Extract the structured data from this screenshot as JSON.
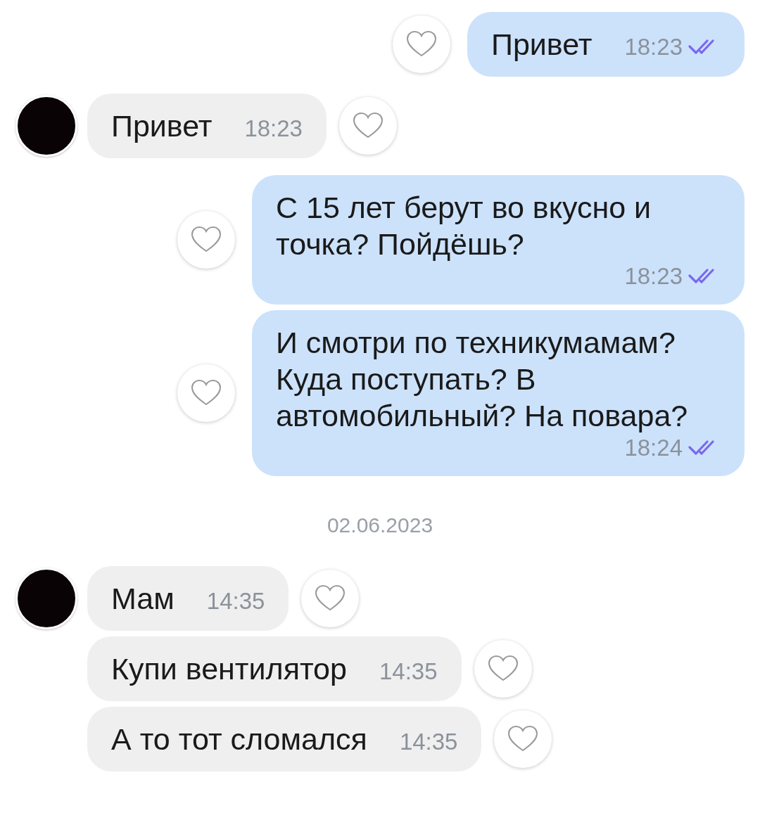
{
  "items": [
    {
      "kind": "message",
      "outgoing": true,
      "text": "Привет",
      "time": "18:23",
      "read": true
    },
    {
      "kind": "message",
      "outgoing": false,
      "avatar": true,
      "text": "Привет",
      "time": "18:23"
    },
    {
      "kind": "message",
      "outgoing": true,
      "text": "С 15 лет берут во вкусно и точка? Пойдёшь?",
      "time": "18:23",
      "read": true
    },
    {
      "kind": "message",
      "outgoing": true,
      "text": "И смотри по техникумамам? Куда поступать? В автомобильный? На повара?",
      "time": "18:24",
      "read": true
    },
    {
      "kind": "date",
      "text": "02.06.2023"
    },
    {
      "kind": "message",
      "outgoing": false,
      "avatar": true,
      "text": "Мам",
      "time": "14:35"
    },
    {
      "kind": "message",
      "outgoing": false,
      "avatar": false,
      "text": "Купи вентилятор",
      "time": "14:35"
    },
    {
      "kind": "message",
      "outgoing": false,
      "avatar": false,
      "text": "А то тот сломался",
      "time": "14:35"
    }
  ]
}
